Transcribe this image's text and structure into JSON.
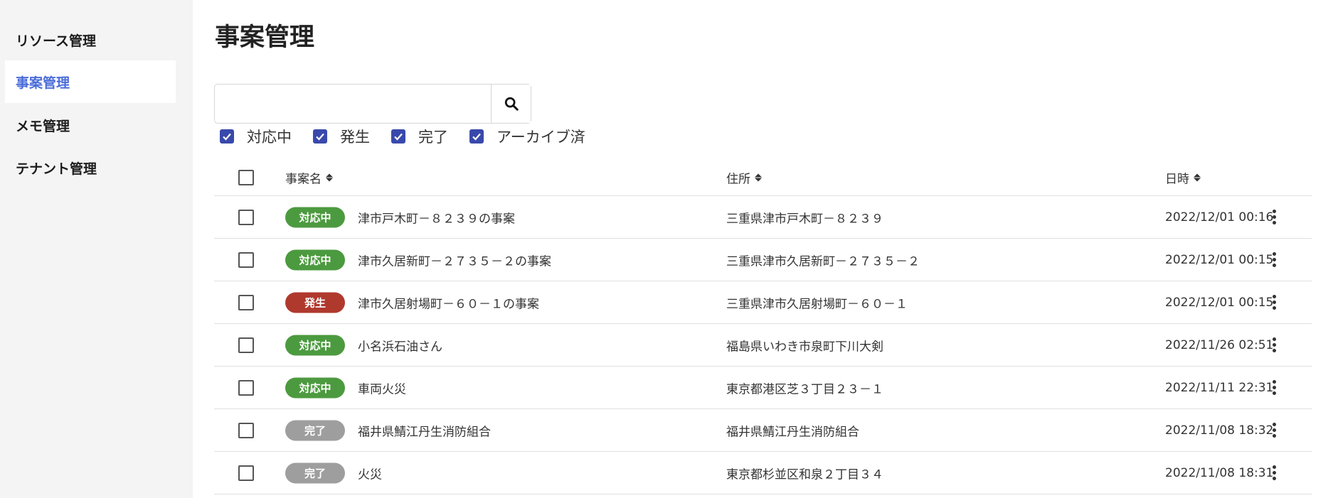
{
  "sidebar": {
    "items": [
      {
        "label": "リソース管理",
        "active": false
      },
      {
        "label": "事案管理",
        "active": true
      },
      {
        "label": "メモ管理",
        "active": false
      },
      {
        "label": "テナント管理",
        "active": false
      }
    ]
  },
  "page": {
    "title": "事案管理"
  },
  "search": {
    "value": "",
    "placeholder": "",
    "icon": "search-icon"
  },
  "filters": [
    {
      "label": "対応中",
      "checked": true
    },
    {
      "label": "発生",
      "checked": true
    },
    {
      "label": "完了",
      "checked": true
    },
    {
      "label": "アーカイブ済",
      "checked": true
    }
  ],
  "table": {
    "headers": {
      "name": "事案名",
      "address": "住所",
      "datetime": "日時"
    },
    "rows": [
      {
        "status": "対応中",
        "status_color": "#4c9a3f",
        "name": "津市戸木町－８２３９の事案",
        "address": "三重県津市戸木町－８２３９",
        "datetime": "2022/12/01 00:16"
      },
      {
        "status": "対応中",
        "status_color": "#4c9a3f",
        "name": "津市久居新町－２７３５－２の事案",
        "address": "三重県津市久居新町－２７３５－２",
        "datetime": "2022/12/01 00:15"
      },
      {
        "status": "発生",
        "status_color": "#b0392e",
        "name": "津市久居射場町－６０－１の事案",
        "address": "三重県津市久居射場町－６０－１",
        "datetime": "2022/12/01 00:15"
      },
      {
        "status": "対応中",
        "status_color": "#4c9a3f",
        "name": "小名浜石油さん",
        "address": "福島県いわき市泉町下川大剣",
        "datetime": "2022/11/26 02:51"
      },
      {
        "status": "対応中",
        "status_color": "#4c9a3f",
        "name": "車両火災",
        "address": "東京都港区芝３丁目２３－１",
        "datetime": "2022/11/11 22:31"
      },
      {
        "status": "完了",
        "status_color": "#9e9e9e",
        "name": "福井県鯖江丹生消防組合",
        "address": "福井県鯖江丹生消防組合",
        "datetime": "2022/11/08 18:32"
      },
      {
        "status": "完了",
        "status_color": "#9e9e9e",
        "name": "火災",
        "address": "東京都杉並区和泉２丁目３４",
        "datetime": "2022/11/08 18:31"
      }
    ]
  },
  "colors": {
    "accent": "#4a6cd9",
    "checkbox": "#3949ab"
  }
}
